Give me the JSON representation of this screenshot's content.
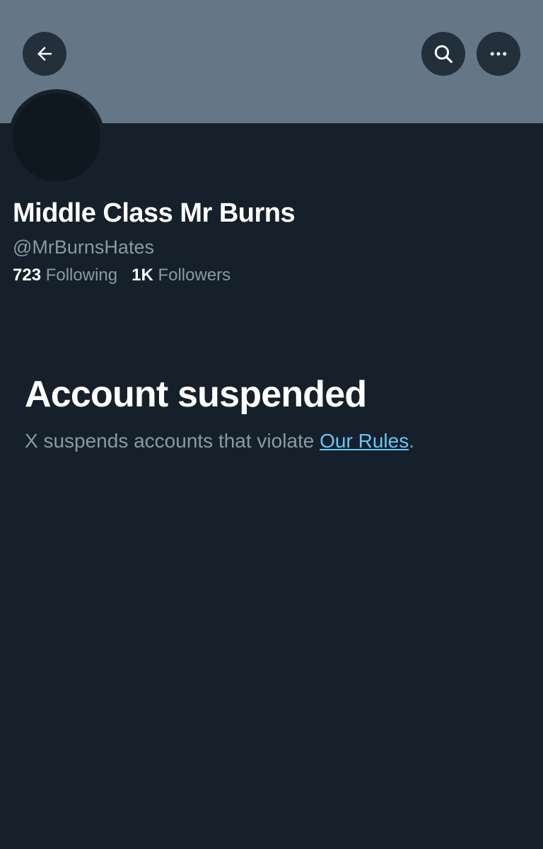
{
  "header": {
    "back_icon": "arrow-left-icon",
    "search_icon": "search-icon",
    "more_icon": "more-horizontal-icon"
  },
  "profile": {
    "name": "Middle Class Mr Burns",
    "handle": "@MrBurnsHates",
    "following_count": "723",
    "following_label": "Following",
    "followers_count": "1K",
    "followers_label": "Followers"
  },
  "notice": {
    "title": "Account suspended",
    "text_before": "X suspends accounts that violate ",
    "link_text": "Our Rules",
    "text_after": "."
  },
  "colors": {
    "background": "#15202b",
    "banner": "#657786",
    "link": "#6cc3f5",
    "secondary_text": "#8b98a5"
  }
}
